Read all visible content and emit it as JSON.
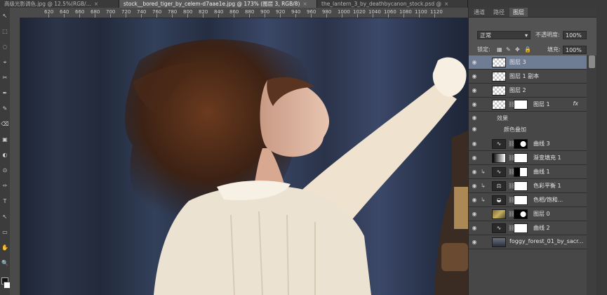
{
  "tabs": [
    {
      "title": "高级光影调色.jpg @ 12.5%(RGB/...",
      "close": "×"
    },
    {
      "title": "stock__bored_tiger_by_celem-d7aae1e.jpg @ 173% (图层 3, RGB/8)",
      "close": "×"
    },
    {
      "title": "the_lantern_3_by_deathbycanon_stock.psd @",
      "close": "×"
    }
  ],
  "ruler": {
    "labels": [
      "620",
      "640",
      "660",
      "680",
      "700",
      "720",
      "740",
      "760",
      "780",
      "800",
      "820",
      "840",
      "860",
      "880",
      "900",
      "920",
      "940",
      "960",
      "980",
      "1000",
      "1020",
      "1040",
      "1060",
      "1080",
      "1100",
      "1120"
    ]
  },
  "tools": [
    "↖",
    "⬚",
    "◌",
    "⌖",
    "✂",
    "✒",
    "✎",
    "⌫",
    "▣",
    "◐",
    "⊙",
    "✑",
    "T",
    "↖",
    "▭",
    "✋",
    "🔍"
  ],
  "panel": {
    "tabs": [
      "通道",
      "路径",
      "图层"
    ],
    "blend_mode": "正常",
    "opacity_label": "不透明度:",
    "opacity_value": "100%",
    "lock_label": "锁定:",
    "fill_label": "填充:",
    "fill_value": "100%",
    "lock_icons": [
      "▦",
      "✎",
      "✥",
      "🔒"
    ],
    "layers": [
      {
        "name": "图层 3",
        "thumb": "checker",
        "selected": true
      },
      {
        "name": "图层 1 副本",
        "thumb": "checker"
      },
      {
        "name": "图层 2",
        "thumb": "checker"
      },
      {
        "name": "图层 1",
        "thumb": "checker",
        "mask": "white",
        "fx": "fx"
      },
      {
        "name": "曲线 3",
        "thumb": "adj",
        "mask": "mask-dark"
      },
      {
        "name": "渐变填充 1",
        "thumb": "gradient",
        "mask": "white"
      },
      {
        "name": "曲线 1",
        "thumb": "adj",
        "mask": "mask-half",
        "clip": true
      },
      {
        "name": "色彩平衡 1",
        "thumb": "adj",
        "mask": "white",
        "clip": true
      },
      {
        "name": "色相/饱和...",
        "thumb": "adj",
        "mask": "white",
        "clip": true
      },
      {
        "name": "图层 0",
        "thumb": "photo",
        "mask": "mask-dark"
      },
      {
        "name": "曲线 2",
        "thumb": "adj",
        "mask": "white"
      },
      {
        "name": "foggy_forest_01_by_sacr...",
        "thumb": "forest"
      }
    ],
    "effects_label": "效果",
    "effect_item": "颜色叠加"
  }
}
